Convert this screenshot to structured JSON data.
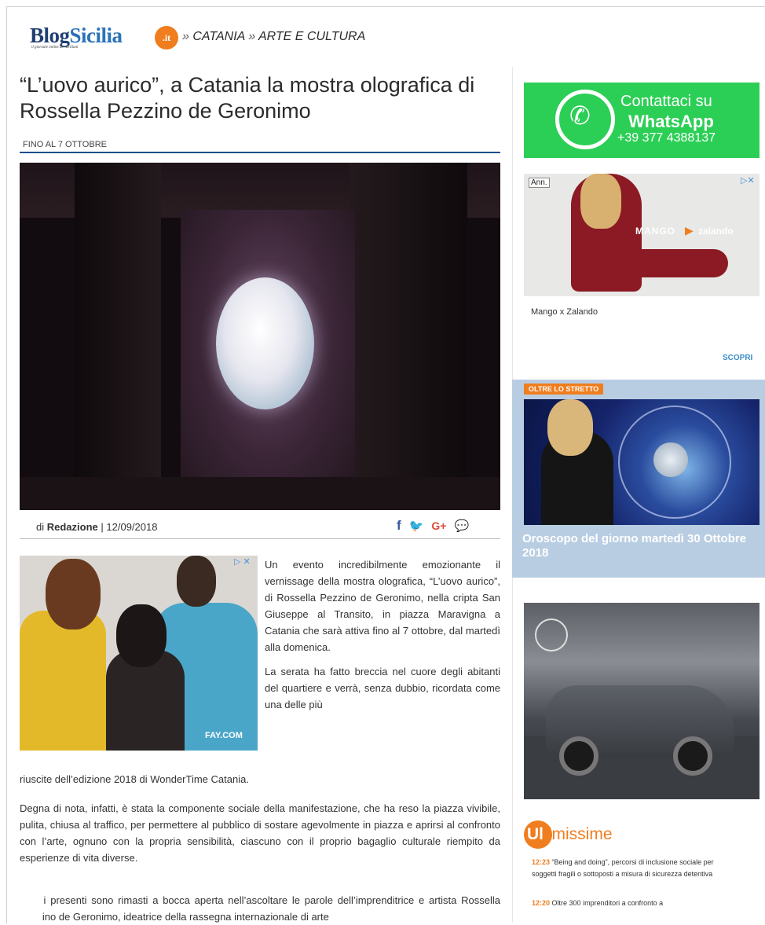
{
  "header": {
    "logo_blog": "Blog",
    "logo_sicilia": "Sicilia",
    "logo_it": ".it",
    "logo_tagline": "il giornale online dei siciliani",
    "breadcrumb_sep1": "»",
    "breadcrumb_1": "CATANIA",
    "breadcrumb_sep2": "»",
    "breadcrumb_2": "ARTE E CULTURA"
  },
  "article": {
    "title": "“L’uovo aurico”, a Catania la mostra olografica di Rossella Pezzino de Geronimo",
    "kicker": "FINO AL 7 OTTOBRE",
    "byline_prefix": "di",
    "author": "Redazione",
    "date_sep": "|",
    "date": "12/09/2018",
    "share": {
      "facebook": "f",
      "twitter": "🐦",
      "gplus": "G+",
      "messenger": "💬"
    },
    "ad_brand": "FAY.COM",
    "ad_close": "▷ ✕",
    "para1": "Un evento incredibilmente emozionante il vernissage della mostra olografica, “L’uovo aurico”, di Rossella Pezzino de Geronimo, nella cripta San Giuseppe al Transito, in piazza Maravigna a Catania che sarà attiva fino al 7 ottobre, dal martedì alla domenica.",
    "para2_wrap": "La serata ha fatto breccia nel cuore degli abitanti del quartiere e verrà, senza dubbio, ricordata come una delle più",
    "para2_full": "riuscite dell’edizione 2018 di WonderTime Catania.",
    "para3": "Degna di nota, infatti, è stata la componente sociale della manifestazione, che ha reso la piazza vivibile, pulita, chiusa al traffico, per permettere al pubblico di sostare agevolmente in piazza e aprirsi al confronto con l’arte, ognuno con la propria sensibilità, ciascuno con il proprio bagaglio culturale riempito da esperienze di vita diverse.",
    "para4": "Tutti i presenti sono rimasti a bocca aperta nell’ascoltare le parole dell’imprenditrice e artista Rossella Pezzino de Geronimo, ideatrice della rassegna internazionale di arte"
  },
  "sidebar": {
    "whatsapp_line1": "Contattaci su",
    "whatsapp_line2": "WhatsApp",
    "whatsapp_phone": "+39 377 4388137",
    "ad_ann": "Ann.",
    "ad_close": "▷✕",
    "ad_mango": "MANGO",
    "ad_play": "▶",
    "ad_zalando": "zalando",
    "ad_caption": "Mango x Zalando",
    "ad_cta": "SCOPRI",
    "promo_tag": "OLTRE LO STRETTO",
    "promo_title": "Oroscopo del giorno martedì 30 Ottobre 2018",
    "ultimissime_ul": "Ul",
    "ultimissime_rest": "timissime",
    "news": [
      {
        "time": "12:23",
        "text": "“Being and doing”, percorsi di inclusione sociale per soggetti fragili o sottoposti a misura di sicurezza detentiva"
      },
      {
        "time": "12:20",
        "text": "Oltre 300 imprenditori a confronto a"
      }
    ]
  },
  "colors": {
    "brand_blue": "#1c4f8b",
    "accent_orange": "#f07d1e",
    "whatsapp_green": "#2ccf55"
  }
}
